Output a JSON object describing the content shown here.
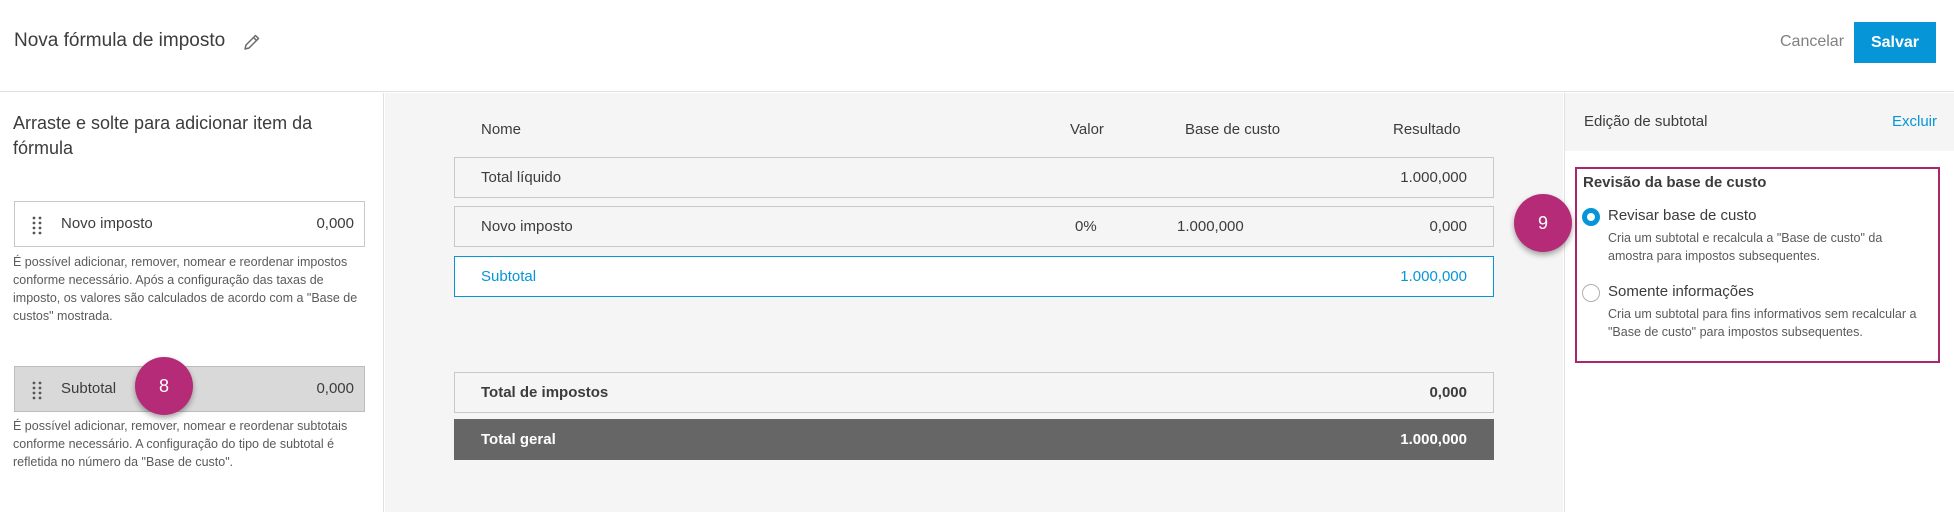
{
  "header": {
    "title": "Nova fórmula de imposto",
    "cancel_label": "Cancelar",
    "save_label": "Salvar"
  },
  "left_panel": {
    "heading": "Arraste e solte para adicionar item da fórmula",
    "items": [
      {
        "label": "Novo imposto",
        "value": "0,000",
        "help": "É possível adicionar, remover, nomear e reordenar impostos conforme necessário. Após a configuração das taxas de imposto, os valores são calculados de acordo com a \"Base de custos\" mostrada."
      },
      {
        "label": "Subtotal",
        "value": "0,000",
        "help": "É possível adicionar, remover, nomear e reordenar subtotais conforme necessário. A configuração do tipo de subtotal é refletida no número da \"Base de custo\"."
      }
    ]
  },
  "formula_table": {
    "columns": {
      "name": "Nome",
      "value": "Valor",
      "cost_base": "Base de custo",
      "result": "Resultado"
    },
    "rows": [
      {
        "name": "Total líquido",
        "value": "",
        "cost_base": "",
        "result": "1.000,000"
      },
      {
        "name": "Novo imposto",
        "value": "0%",
        "cost_base": "1.000,000",
        "result": "0,000"
      },
      {
        "name": "Subtotal",
        "value": "",
        "cost_base": "",
        "result": "1.000,000"
      }
    ],
    "total_taxes": {
      "name": "Total de impostos",
      "result": "0,000"
    },
    "grand_total": {
      "name": "Total geral",
      "result": "1.000,000"
    }
  },
  "right_panel": {
    "title": "Edição de subtotal",
    "delete_label": "Excluir",
    "section_title": "Revisão da base de custo",
    "options": [
      {
        "label": "Revisar base de custo",
        "desc": "Cria um subtotal e recalcula a \"Base de custo\" da amostra para impostos subsequentes.",
        "selected": true
      },
      {
        "label": "Somente informações",
        "desc": "Cria um subtotal para fins informativos sem recalcular a \"Base de custo\" para impostos subsequentes.",
        "selected": false
      }
    ]
  },
  "callouts": {
    "left": "8",
    "right": "9"
  },
  "colors": {
    "accent": "#0696d7",
    "callout": "#b52b78",
    "highlight": "#a8286e"
  }
}
